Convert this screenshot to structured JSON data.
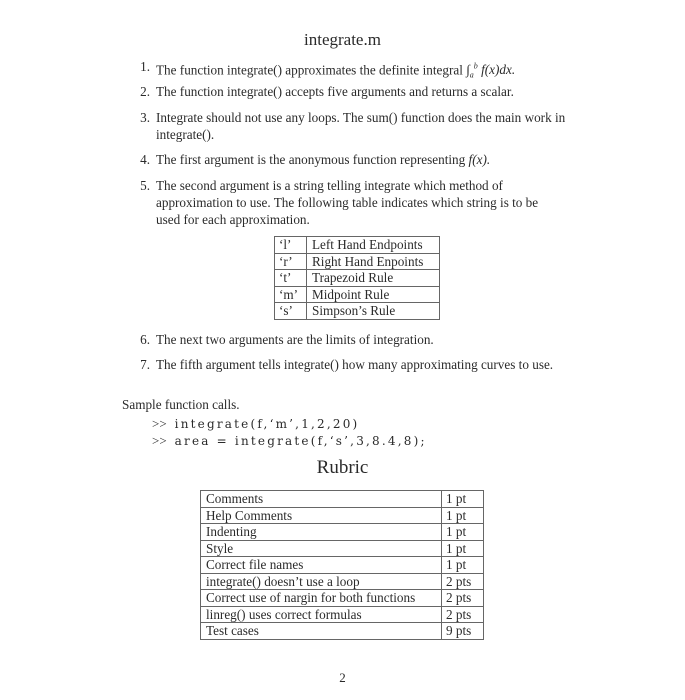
{
  "title": "integrate.m",
  "items": [
    {
      "num": "1.",
      "text": "The function integrate() approximates the definite integral",
      "math": {
        "lower": "a",
        "upper": "b",
        "expr": "f(x)dx."
      }
    },
    {
      "num": "2.",
      "text": "The function integrate() accepts five arguments and returns a scalar."
    },
    {
      "num": "3.",
      "text": "Integrate should not use any loops. The sum() function does the main work in integrate()."
    },
    {
      "num": "4.",
      "text": "The first argument is the anonymous function representing",
      "math_tail": "f(x)."
    },
    {
      "num": "5.",
      "text": "The second argument is a string telling integrate which method of approximation to use. The following table indicates which string is to be used for each approximation."
    },
    {
      "num": "6.",
      "text": "The next two arguments are the limits of integration."
    },
    {
      "num": "7.",
      "text": "The fifth argument tells integrate() how many approximating curves to use."
    }
  ],
  "approx_table": [
    {
      "key": "‘l’",
      "method": "Left Hand Endpoints"
    },
    {
      "key": "‘r’",
      "method": "Right Hand Enpoints"
    },
    {
      "key": "‘t’",
      "method": "Trapezoid Rule"
    },
    {
      "key": "‘m’",
      "method": "Midpoint Rule"
    },
    {
      "key": "‘s’",
      "method": "Simpson’s Rule"
    }
  ],
  "sample": {
    "heading": "Sample function calls.",
    "prompt": ">>",
    "calls": [
      "integrate(f,‘m’,1,2,20)",
      "area = integrate(f,‘s’,3,8.4,8);"
    ]
  },
  "rubric": {
    "title": "Rubric",
    "rows": [
      {
        "criterion": "Comments",
        "points": "1 pt"
      },
      {
        "criterion": "Help Comments",
        "points": "1 pt"
      },
      {
        "criterion": "Indenting",
        "points": "1 pt"
      },
      {
        "criterion": "Style",
        "points": "1 pt"
      },
      {
        "criterion": "Correct file names",
        "points": "1 pt"
      },
      {
        "criterion": "integrate() doesn’t use a loop",
        "points": "2 pts"
      },
      {
        "criterion": "Correct use of nargin for both functions",
        "points": "2 pts"
      },
      {
        "criterion": "linreg() uses correct formulas",
        "points": "2 pts"
      },
      {
        "criterion": "Test cases",
        "points": "9 pts"
      }
    ]
  },
  "page_number": "2"
}
